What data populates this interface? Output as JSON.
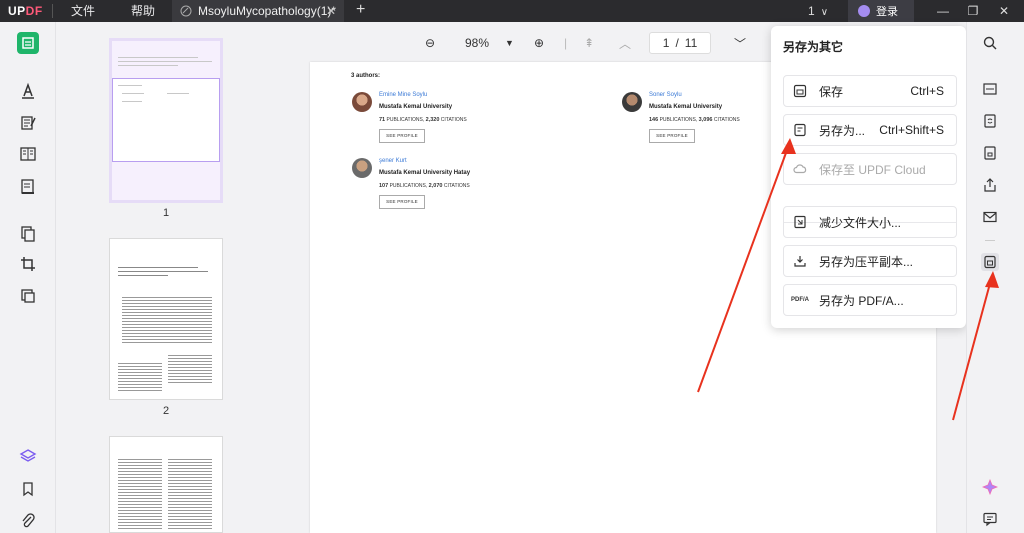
{
  "titlebar": {
    "logo_part1": "UP",
    "logo_part2": "DF",
    "menu": [
      "文件",
      "帮助"
    ],
    "tab_title": "MsoyluMycopathology(1)*",
    "tab_close": "✕",
    "new_tab": "+",
    "page_count": "1",
    "login": "登录",
    "minimize": "—",
    "restore": "❐",
    "close": "✕"
  },
  "viewer": {
    "zoom_out": "⊖",
    "zoom_level": "98%",
    "zoom_in": "⊕",
    "current_page": "1",
    "page_sep": "/",
    "total_pages": "11"
  },
  "thumbnails": {
    "pages": [
      "1",
      "2"
    ]
  },
  "document": {
    "authors_label": "3 authors:",
    "authors": [
      {
        "name": "Emine Mine Soylu",
        "affiliation": "Mustafa Kemal University",
        "pubs": "71",
        "pubs_label": "PUBLICATIONS",
        "cites": "2,320",
        "cites_label": "CITATIONS",
        "profile": "SEE PROFILE"
      },
      {
        "name": "Soner Soylu",
        "affiliation": "Mustafa Kemal University",
        "pubs": "146",
        "pubs_label": "PUBLICATIONS",
        "cites": "3,096",
        "cites_label": "CITATIONS",
        "profile": "SEE PROFILE"
      },
      {
        "name": "şener Kurt",
        "affiliation": "Mustafa Kemal University Hatay",
        "pubs": "107",
        "pubs_label": "PUBLICATIONS",
        "cites": "2,070",
        "cites_label": "CITATIONS",
        "profile": "SEE PROFILE"
      }
    ]
  },
  "popup": {
    "title": "另存为其它",
    "items": [
      {
        "label": "保存",
        "shortcut": "Ctrl+S",
        "icon": "save-icon"
      },
      {
        "label": "另存为...",
        "shortcut": "Ctrl+Shift+S",
        "icon": "save-as-icon"
      },
      {
        "label": "保存至 UPDF Cloud",
        "shortcut": "",
        "icon": "cloud-icon"
      },
      {
        "label": "减少文件大小...",
        "shortcut": "",
        "icon": "compress-icon"
      },
      {
        "label": "另存为压平副本...",
        "shortcut": "",
        "icon": "flatten-icon"
      },
      {
        "label": "另存为 PDF/A...",
        "shortcut": "",
        "icon": "pdfa-icon"
      }
    ]
  },
  "colors": {
    "accent": "#7b5cf0",
    "arrow": "#e8321e",
    "titlebar_bg": "#2b2b2e"
  }
}
